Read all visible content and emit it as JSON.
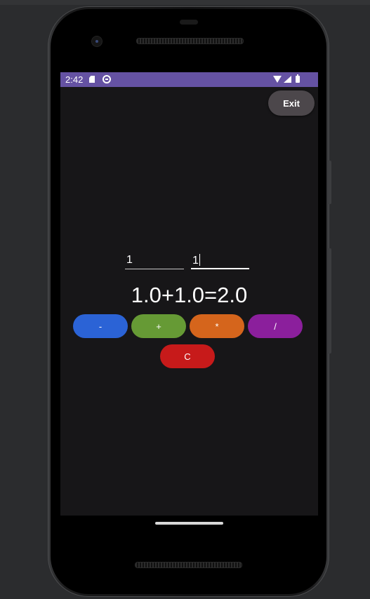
{
  "status_bar": {
    "time": "2:42",
    "background": "#6552a3",
    "icons": [
      "sd-card-icon",
      "circle-icon",
      "wifi-icon",
      "signal-icon",
      "battery-icon"
    ]
  },
  "toolbar": {
    "exit_label": "Exit"
  },
  "inputs": {
    "first_value": "1",
    "second_value": "1"
  },
  "result": {
    "text": "1.0+1.0=2.0"
  },
  "operations": {
    "minus_label": "-",
    "plus_label": "+",
    "multiply_label": "*",
    "divide_label": "/",
    "clear_label": "C"
  },
  "colors": {
    "minus": "#2b63d6",
    "plus": "#669a35",
    "multiply": "#d5651c",
    "divide": "#8b1f9c",
    "clear": "#c71a1a",
    "exit": "#4c474b"
  }
}
